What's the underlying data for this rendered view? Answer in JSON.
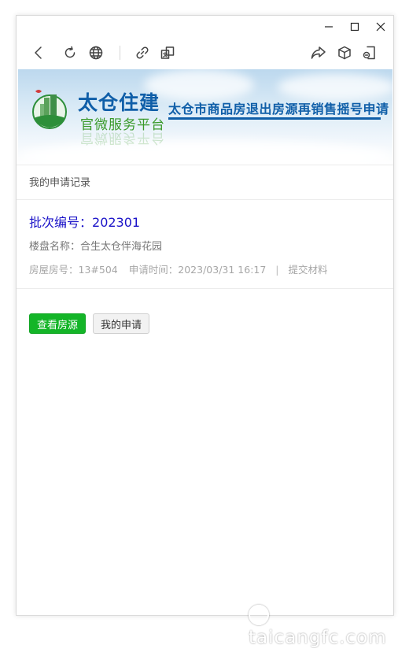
{
  "window": {
    "controls": [
      "minimize-icon",
      "maximize-icon",
      "close-icon"
    ]
  },
  "toolbar": {
    "left_icons": [
      "back-arrow-icon",
      "refresh-icon",
      "globe-icon",
      "link-icon",
      "translate-icon"
    ],
    "right_icons": [
      "share-icon",
      "cube-icon",
      "mini-program-icon"
    ]
  },
  "banner": {
    "brand_name": "太仓住建",
    "brand_sub": "官微服务平台",
    "title": "太仓市商品房退出房源再销售摇号申请",
    "colors": {
      "brand_blue": "#0f5ea8",
      "brand_green": "#3a9a2a"
    }
  },
  "section": {
    "title": "我的申请记录"
  },
  "record": {
    "batch_label": "批次编号：",
    "batch_no": "202301",
    "project_label": "楼盘名称：",
    "project_name": "合生太仓伴海花园",
    "room_label": "房屋房号：",
    "room_no": "13#504",
    "time_label": "申请时间：",
    "apply_time": "2023/03/31 16:17",
    "separator": "|",
    "submit_link": "提交材料"
  },
  "actions": {
    "view_listings": "查看房源",
    "my_applications": "我的申请",
    "colors": {
      "primary": "#14b528"
    }
  },
  "watermark": {
    "text": "taicangfc.com"
  }
}
